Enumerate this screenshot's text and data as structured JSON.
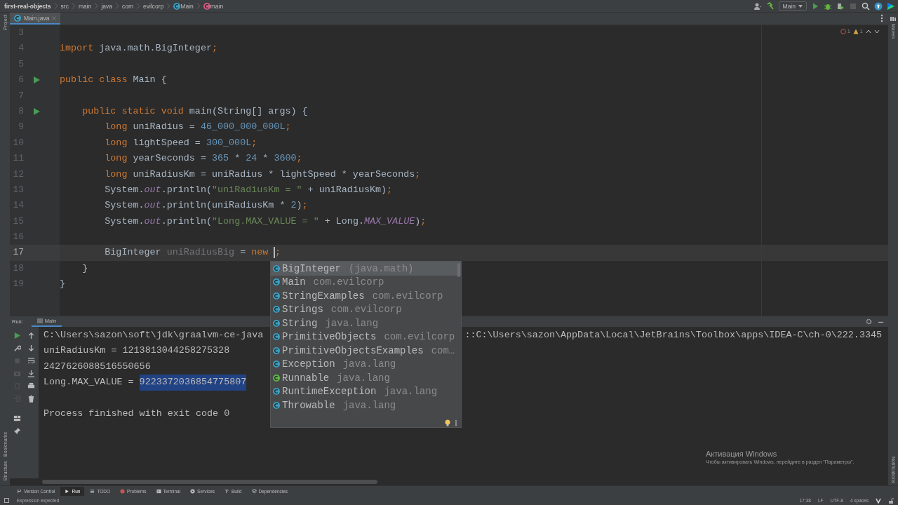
{
  "breadcrumbs": [
    {
      "label": "first-real-objects",
      "kind": "project"
    },
    {
      "label": "src",
      "kind": "folder"
    },
    {
      "label": "main",
      "kind": "folder"
    },
    {
      "label": "java",
      "kind": "folder"
    },
    {
      "label": "com",
      "kind": "folder"
    },
    {
      "label": "evilcorp",
      "kind": "folder"
    },
    {
      "label": "Main",
      "kind": "class"
    },
    {
      "label": "main",
      "kind": "method"
    }
  ],
  "run_config": "Main",
  "left_stripe": {
    "top": [
      "Project"
    ],
    "bottom": [
      "Bookmarks",
      "Structure"
    ]
  },
  "right_stripe": {
    "top": [
      "Maven"
    ],
    "bottom": [
      "Notifications"
    ]
  },
  "tabs": [
    {
      "label": "Main.java",
      "selected": true
    }
  ],
  "inspections": {
    "errors": "1",
    "warnings": "1"
  },
  "code_lines": [
    {
      "number": "3",
      "run": false,
      "current": false
    },
    {
      "number": "4",
      "run": false,
      "current": false,
      "tokens": [
        {
          "text": "import",
          "kind": "keyword"
        },
        {
          "text": " java.math.BigInteger",
          "kind": "plain"
        },
        {
          "text": ";",
          "kind": "keyword"
        }
      ]
    },
    {
      "number": "5",
      "run": false,
      "current": false
    },
    {
      "number": "6",
      "run": true,
      "current": false,
      "tokens": [
        {
          "text": "public class",
          "kind": "keyword"
        },
        {
          "text": " Main {",
          "kind": "plain"
        }
      ]
    },
    {
      "number": "7",
      "run": false,
      "current": false
    },
    {
      "number": "8",
      "run": true,
      "current": false,
      "tokens": [
        {
          "text": "    public static void",
          "kind": "keyword"
        },
        {
          "text": " main(String[] args) {",
          "kind": "plain"
        }
      ]
    },
    {
      "number": "9",
      "run": false,
      "current": false,
      "tokens": [
        {
          "text": "        long",
          "kind": "keyword"
        },
        {
          "text": " uniRadius = ",
          "kind": "plain"
        },
        {
          "text": "46_000_000_000L",
          "kind": "number"
        },
        {
          "text": ";",
          "kind": "keyword"
        }
      ]
    },
    {
      "number": "10",
      "run": false,
      "current": false,
      "tokens": [
        {
          "text": "        long",
          "kind": "keyword"
        },
        {
          "text": " lightSpeed = ",
          "kind": "plain"
        },
        {
          "text": "300_000L",
          "kind": "number"
        },
        {
          "text": ";",
          "kind": "keyword"
        }
      ]
    },
    {
      "number": "11",
      "run": false,
      "current": false,
      "tokens": [
        {
          "text": "        long",
          "kind": "keyword"
        },
        {
          "text": " yearSeconds = ",
          "kind": "plain"
        },
        {
          "text": "365",
          "kind": "number"
        },
        {
          "text": " * ",
          "kind": "plain"
        },
        {
          "text": "24",
          "kind": "number"
        },
        {
          "text": " * ",
          "kind": "plain"
        },
        {
          "text": "3600",
          "kind": "number"
        },
        {
          "text": ";",
          "kind": "keyword"
        }
      ]
    },
    {
      "number": "12",
      "run": false,
      "current": false,
      "tokens": [
        {
          "text": "        long",
          "kind": "keyword"
        },
        {
          "text": " uniRadiusKm = uniRadius * lightSpeed * yearSeconds",
          "kind": "plain"
        },
        {
          "text": ";",
          "kind": "keyword"
        }
      ]
    },
    {
      "number": "13",
      "run": false,
      "current": false,
      "tokens": [
        {
          "text": "        System.",
          "kind": "plain"
        },
        {
          "text": "out",
          "kind": "field"
        },
        {
          "text": ".println(",
          "kind": "plain"
        },
        {
          "text": "\"uniRadiusKm = \"",
          "kind": "string"
        },
        {
          "text": " + uniRadiusKm)",
          "kind": "plain"
        },
        {
          "text": ";",
          "kind": "keyword"
        }
      ]
    },
    {
      "number": "14",
      "run": false,
      "current": false,
      "tokens": [
        {
          "text": "        System.",
          "kind": "plain"
        },
        {
          "text": "out",
          "kind": "field"
        },
        {
          "text": ".println(uniRadiusKm * ",
          "kind": "plain"
        },
        {
          "text": "2",
          "kind": "number"
        },
        {
          "text": ")",
          "kind": "plain"
        },
        {
          "text": ";",
          "kind": "keyword"
        }
      ]
    },
    {
      "number": "15",
      "run": false,
      "current": false,
      "tokens": [
        {
          "text": "        System.",
          "kind": "plain"
        },
        {
          "text": "out",
          "kind": "field"
        },
        {
          "text": ".println(",
          "kind": "plain"
        },
        {
          "text": "\"Long.MAX_VALUE = \"",
          "kind": "string"
        },
        {
          "text": " + Long.",
          "kind": "plain"
        },
        {
          "text": "MAX_VALUE",
          "kind": "field"
        },
        {
          "text": ")",
          "kind": "plain"
        },
        {
          "text": ";",
          "kind": "keyword"
        }
      ]
    },
    {
      "number": "16",
      "run": false,
      "current": false
    },
    {
      "number": "17",
      "run": false,
      "current": true,
      "tokens": [
        {
          "text": "        BigInteger",
          "kind": "plain"
        },
        {
          "text": " uniRadiusBig",
          "kind": "unused"
        },
        {
          "text": " = ",
          "kind": "plain"
        },
        {
          "text": "new ",
          "kind": "keyword"
        },
        {
          "text": ";",
          "kind": "keyword",
          "caret_before": true
        }
      ]
    },
    {
      "number": "18",
      "run": false,
      "current": false,
      "tokens": [
        {
          "text": "    }",
          "kind": "plain"
        }
      ]
    },
    {
      "number": "19",
      "run": false,
      "current": false,
      "tokens": [
        {
          "text": "}",
          "kind": "plain"
        }
      ]
    }
  ],
  "completion": {
    "items": [
      {
        "name": "BigInteger",
        "location": "(java.math)",
        "kind": "class",
        "selected": true
      },
      {
        "name": "Main",
        "location": "com.evilcorp",
        "kind": "class",
        "selected": false
      },
      {
        "name": "StringExamples",
        "location": "com.evilcorp",
        "kind": "class",
        "selected": false
      },
      {
        "name": "Strings",
        "location": "com.evilcorp",
        "kind": "class",
        "selected": false
      },
      {
        "name": "String",
        "location": "java.lang",
        "kind": "class",
        "selected": false
      },
      {
        "name": "PrimitiveObjects",
        "location": "com.evilcorp",
        "kind": "class",
        "selected": false
      },
      {
        "name": "PrimitiveObjectsExamples",
        "location": "com…",
        "kind": "class",
        "selected": false
      },
      {
        "name": "Exception",
        "location": "java.lang",
        "kind": "class",
        "selected": false
      },
      {
        "name": "Runnable",
        "location": "java.lang",
        "kind": "interface",
        "selected": false
      },
      {
        "name": "RuntimeException",
        "location": "java.lang",
        "kind": "class",
        "selected": false
      },
      {
        "name": "Throwable",
        "location": "java.lang",
        "kind": "class",
        "selected": false
      }
    ]
  },
  "run_panel": {
    "label": "Run:",
    "tabs": [
      {
        "label": "Main",
        "selected": true
      }
    ],
    "output": [
      {
        "segments": [
          {
            "text": "C:\\Users\\sazon\\soft\\jdk\\graalvm-ce-java",
            "selected": false
          },
          {
            "text": "::C:\\Users\\sazon\\AppData\\Local\\JetBrains\\Toolbox\\apps\\IDEA-C\\ch-0\\222.3345",
            "selected": false
          }
        ]
      },
      {
        "segments": [
          {
            "text": "uniRadiusKm = 1213813044258275328",
            "selected": false
          }
        ]
      },
      {
        "segments": [
          {
            "text": "2427626088516550656",
            "selected": false
          }
        ]
      },
      {
        "segments": [
          {
            "text": "Long.MAX_VALUE = ",
            "selected": false
          },
          {
            "text": "9223372036854775807",
            "selected": true
          }
        ]
      },
      {
        "separated": true,
        "segments": [
          {
            "text": "Process finished with exit code 0",
            "selected": false
          }
        ]
      }
    ]
  },
  "tool_windows": [
    {
      "label": "Version Control",
      "kind": "vcs",
      "selected": false
    },
    {
      "label": "Run",
      "kind": "run",
      "selected": true
    },
    {
      "label": "TODO",
      "kind": "todo",
      "selected": false
    },
    {
      "label": "Problems",
      "kind": "problems",
      "selected": false
    },
    {
      "label": "Terminal",
      "kind": "terminal",
      "selected": false
    },
    {
      "label": "Services",
      "kind": "services",
      "selected": false
    },
    {
      "label": "Build",
      "kind": "build",
      "selected": false
    },
    {
      "label": "Dependencies",
      "kind": "dependencies",
      "selected": false
    }
  ],
  "status_bar": {
    "message": "Expression expected",
    "items": [
      "17:38",
      "LF",
      "UTF-8",
      "4 spaces"
    ]
  },
  "os_notice": {
    "title": "Активация Windows",
    "text": "Чтобы активировать Windows, перейдите в раздел \"Параметры\"."
  }
}
